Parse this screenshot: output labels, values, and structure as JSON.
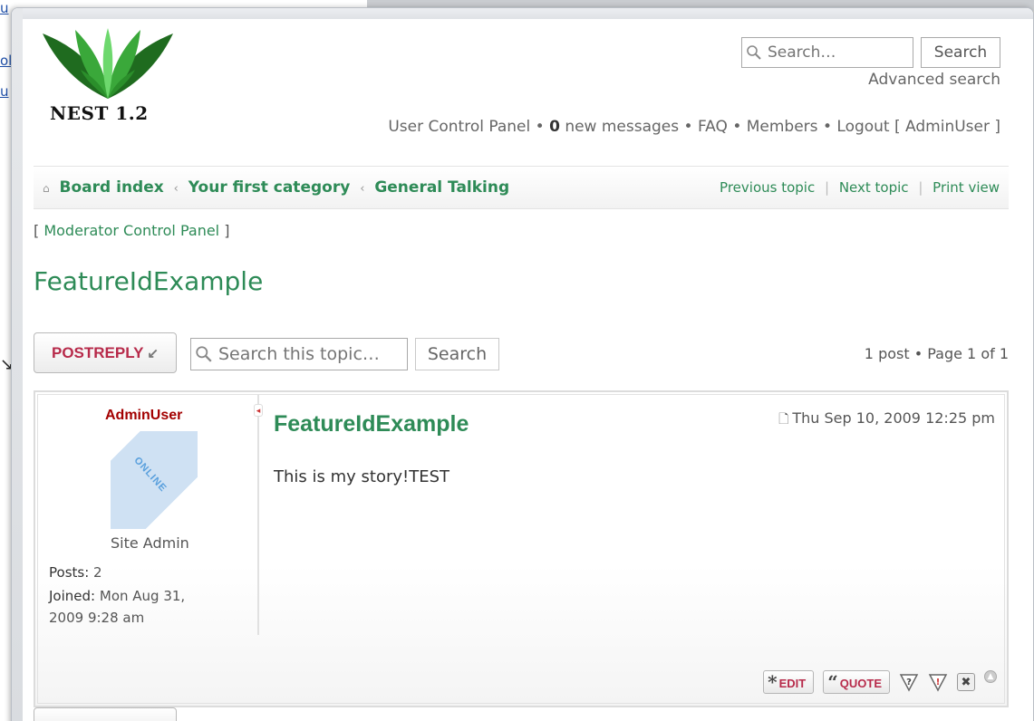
{
  "site": {
    "logo_text": "NEST 1.2"
  },
  "header": {
    "search_placeholder": "Search…",
    "search_button": "Search",
    "advanced_search": "Advanced search",
    "user_control_panel": "User Control Panel",
    "new_messages_count": "0",
    "new_messages_label": "new messages",
    "faq": "FAQ",
    "members": "Members",
    "logout": "Logout [ AdminUser ]"
  },
  "breadcrumb": {
    "items": [
      "Board index",
      "Your first category",
      "General Talking"
    ]
  },
  "navlinks": {
    "previous": "Previous topic",
    "next": "Next topic",
    "print": "Print view"
  },
  "moderator": {
    "prefix": "[ ",
    "link": "Moderator Control Panel",
    "suffix": " ]"
  },
  "topic": {
    "title": "FeatureIdExample",
    "postreply_label": "POSTREPLY",
    "search_placeholder": "Search this topic…",
    "search_button": "Search",
    "pagination": "1 post • Page 1 of 1"
  },
  "post": {
    "author": "AdminUser",
    "online_label": "ONLINE",
    "rank": "Site Admin",
    "posts_label": "Posts:",
    "posts_value": "2",
    "joined_label": "Joined:",
    "joined_value_line1": "Mon Aug 31,",
    "joined_value_line2": "2009 9:28 am",
    "title": "FeatureIdExample",
    "date": "Thu Sep 10, 2009 12:25 pm",
    "body": "This is my story!TEST",
    "edit_label": "EDIT",
    "quote_label": "QUOTE"
  },
  "background": {
    "link_fragments": [
      "u",
      "ol",
      "u"
    ]
  },
  "colors": {
    "accent_green": "#2e8b57",
    "button_red": "#b72a4a",
    "author_red": "#a30000",
    "online_blue": "#5aa0dd"
  }
}
